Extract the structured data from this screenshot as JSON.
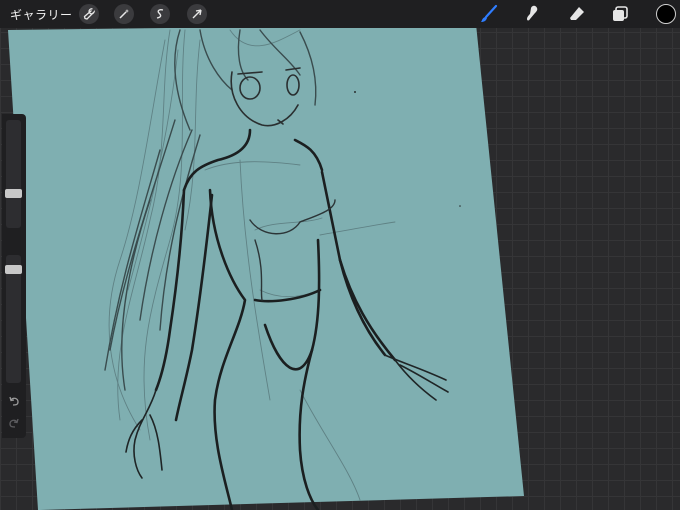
{
  "app": {
    "gallery_label": "ギャラリー"
  },
  "toolbar": {
    "left_tools": [
      {
        "name": "actions",
        "icon": "wrench-icon"
      },
      {
        "name": "adjustments",
        "icon": "magic-wand-icon"
      },
      {
        "name": "selection",
        "icon": "selection-s-icon"
      },
      {
        "name": "transform",
        "icon": "arrow-cursor-icon"
      }
    ],
    "right_tools": [
      {
        "name": "brush",
        "icon": "brush-icon",
        "active": true
      },
      {
        "name": "smudge",
        "icon": "smudge-icon",
        "active": false
      },
      {
        "name": "eraser",
        "icon": "eraser-icon",
        "active": false
      },
      {
        "name": "layers",
        "icon": "layers-icon",
        "active": false
      }
    ],
    "current_color": "#000000",
    "active_tool_color": "#2f7dff"
  },
  "sidebar": {
    "brush_size_level": 0.3,
    "opacity_level": 0.92,
    "modify_icon": "square-modify-icon",
    "undo_icon": "undo-icon",
    "redo_icon": "redo-icon"
  },
  "canvas": {
    "background_color": "#7fafb1",
    "workspace_color": "#2a2a2c",
    "content": "figure-sketch-artwork"
  }
}
